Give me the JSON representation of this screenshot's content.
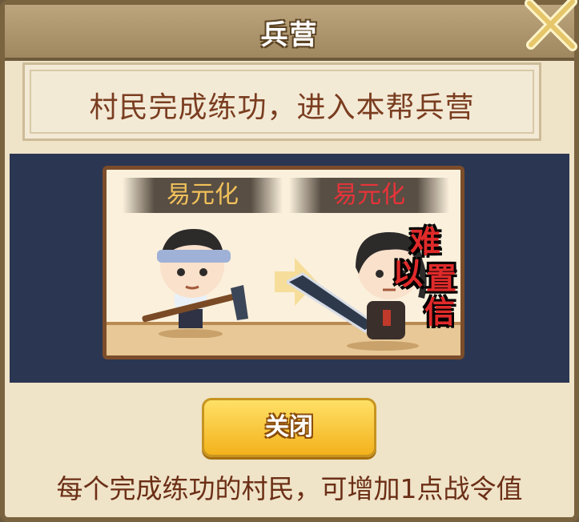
{
  "dialog": {
    "title": "兵营",
    "subtitle": "村民完成练功，进入本帮兵营",
    "close_button_label": "关闭",
    "footer": "每个完成练功的村民，可增加1点战令值"
  },
  "scene": {
    "left_character_name": "易元化",
    "right_character_name": "易元化",
    "stamp_chars": [
      "难",
      "以",
      "置",
      "信"
    ]
  },
  "colors": {
    "panel_bg": "#2b3652",
    "dialog_bg": "#efe3c8",
    "title_bar": "#a8916a",
    "left_name": "#f2c15a",
    "right_name": "#e8333a",
    "button": "#f7c531"
  }
}
